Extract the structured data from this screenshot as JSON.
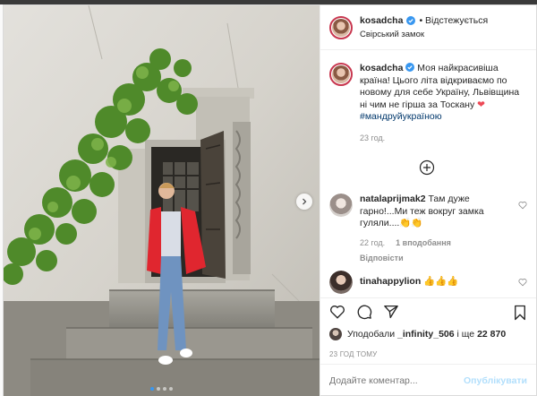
{
  "post": {
    "username": "kosadcha",
    "follow_label": "• Відстежується",
    "location": "Свірський замок",
    "caption_text": "Моя найкрасивіша країна! Цього літа відкриваємо по новому для себе Україну, Львівщина ні чим не гірша за Тоскану",
    "caption_emoji": "❤",
    "hashtag": "#мандруйукраїною",
    "caption_time": "23 год.",
    "comments": [
      {
        "username": "natalaprijmak2",
        "text": "Там дуже гарно!...Ми теж вокруг замка гуляли....👏👏",
        "time": "22 год.",
        "likes": "1 вподобання",
        "reply_label": "Відповісти"
      },
      {
        "username": "tinahappylion",
        "text": "👍👍👍"
      }
    ],
    "likes_prefix": "Уподобали ",
    "likes_user": "_infinity_506",
    "likes_suffix": " і ще ",
    "likes_count": "22 870",
    "post_time": "23 ГОД ТОМУ",
    "comment_placeholder": "Додайте коментар...",
    "publish_label": "Опублікувати",
    "carousel_active_index": 1,
    "carousel_count": 4
  },
  "colors": {
    "link": "#00376b",
    "publish_disabled": "#b2dffc",
    "accent_dot": "#3897f0"
  },
  "icons": [
    "verified-badge-icon",
    "plus-circle-icon",
    "heart-icon",
    "comment-icon",
    "share-icon",
    "bookmark-icon",
    "chevron-right-icon"
  ]
}
